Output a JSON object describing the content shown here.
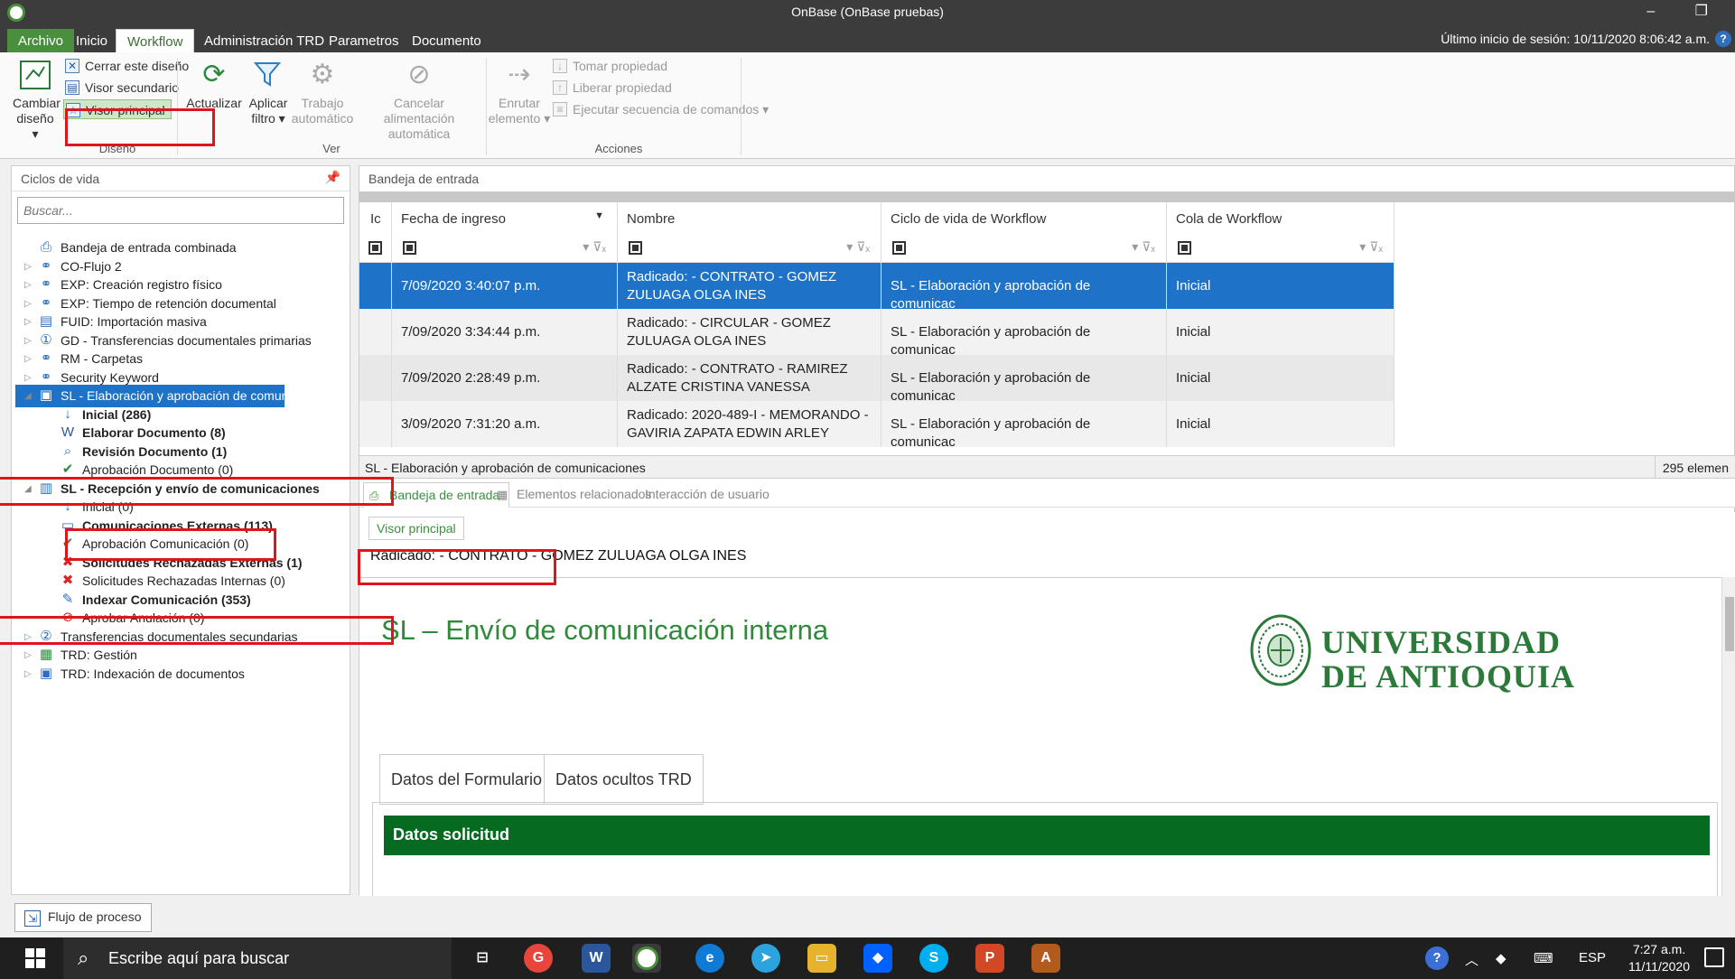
{
  "window": {
    "title": "OnBase (OnBase pruebas)",
    "controls": "– ❐"
  },
  "menu": {
    "tabs": [
      "Archivo",
      "Inicio",
      "Workflow",
      "Administración TRD",
      "Parametros",
      "Documento"
    ],
    "active": "Workflow",
    "session": "Último inicio de sesión: 10/11/2020 8:06:42 a.m.",
    "help": "?"
  },
  "ribbon": {
    "diseno": {
      "cambiar_label1": "Cambiar",
      "cambiar_label2": "diseño ▾",
      "cerrar": "Cerrar este diseño",
      "secundario": "Visor secundario",
      "principal": "Visor principal",
      "group": "Diseño"
    },
    "ver": {
      "actualizar": "Actualizar",
      "aplicar1": "Aplicar",
      "aplicar2": "filtro ▾",
      "trabajo1": "Trabajo",
      "trabajo2": "automático",
      "cancelar1": "Cancelar alimentación",
      "cancelar2": "automática",
      "group": "Ver"
    },
    "acciones": {
      "enrutar1": "Enrutar",
      "enrutar2": "elemento ▾",
      "tomar": "Tomar propiedad",
      "liberar": "Liberar propiedad",
      "ejecutar": "Ejecutar secuencia de comandos ▾",
      "group": "Acciones"
    }
  },
  "left_panel": {
    "title": "Ciclos de vida",
    "search_placeholder": "Buscar...",
    "tree": [
      {
        "label": "Bandeja de entrada combinada",
        "icon": "inbox-icon"
      },
      {
        "label": "CO-Flujo 2",
        "icon": "workflow-icon"
      },
      {
        "label": "EXP: Creación registro físico",
        "icon": "workflow-icon"
      },
      {
        "label": "EXP: Tiempo de retención documental",
        "icon": "workflow-icon"
      },
      {
        "label": "FUID: Importación masiva",
        "icon": "document-icon"
      },
      {
        "label": "GD - Transferencias documentales primarias",
        "icon": "number-one-icon"
      },
      {
        "label": "RM - Carpetas",
        "icon": "workflow-icon"
      },
      {
        "label": "Security Keyword",
        "icon": "workflow-icon"
      },
      {
        "label": "SL - Elaboración y aprobación de comunic...",
        "icon": "lifecycle-icon"
      },
      {
        "label": "Inicial (286)",
        "icon": "arrow-down-icon"
      },
      {
        "label": "Elaborar Documento (8)",
        "icon": "word-doc-icon"
      },
      {
        "label": "Revisión Documento (1)",
        "icon": "review-icon"
      },
      {
        "label": "Aprobación Documento (0)",
        "icon": "check-icon"
      },
      {
        "label": "SL - Recepción y envío de comunicaciones",
        "icon": "book-icon"
      },
      {
        "label": "Inicial (0)",
        "icon": "arrow-down-icon"
      },
      {
        "label": "Comunicaciones Externas (113)",
        "icon": "screen-icon"
      },
      {
        "label": "Aprobación Comunicación (0)",
        "icon": "check-icon"
      },
      {
        "label": "Solicitudes Rechazadas Externas (1)",
        "icon": "reject-icon"
      },
      {
        "label": "Solicitudes Rechazadas Internas (0)",
        "icon": "reject-icon"
      },
      {
        "label": "Indexar Comunicación (353)",
        "icon": "index-icon"
      },
      {
        "label": "Aprobar Anulación (0)",
        "icon": "cancel-icon"
      },
      {
        "label": "Transferencias documentales secundarias",
        "icon": "number-two-icon"
      },
      {
        "label": "TRD: Gestión",
        "icon": "grid-icon"
      },
      {
        "label": "TRD: Indexación de documentos",
        "icon": "save-icon"
      }
    ]
  },
  "inbox": {
    "title": "Bandeja de entrada",
    "columns": [
      "Ic",
      "Fecha de ingreso",
      "Nombre",
      "Ciclo de vida de Workflow",
      "Cola de Workflow"
    ],
    "rows": [
      {
        "fecha": "7/09/2020 3:40:07 p.m.",
        "nombre1": "Radicado:  - CONTRATO - GOMEZ",
        "nombre2": "ZULUAGA OLGA INES",
        "ciclo": "SL - Elaboración y aprobación de comunicac",
        "cola": "Inicial"
      },
      {
        "fecha": "7/09/2020 3:34:44 p.m.",
        "nombre1": "Radicado:  - CIRCULAR - GOMEZ",
        "nombre2": "ZULUAGA OLGA INES",
        "ciclo": "SL - Elaboración y aprobación de comunicac",
        "cola": "Inicial"
      },
      {
        "fecha": "7/09/2020 2:28:49 p.m.",
        "nombre1": "Radicado:  - CONTRATO - RAMIREZ",
        "nombre2": "ALZATE CRISTINA VANESSA",
        "ciclo": "SL - Elaboración y aprobación de comunicac",
        "cola": "Inicial"
      },
      {
        "fecha": "3/09/2020 7:31:20 a.m.",
        "nombre1": "Radicado: 2020-489-I - MEMORANDO -",
        "nombre2": "GAVIRIA ZAPATA EDWIN ARLEY",
        "ciclo": "SL - Elaboración y aprobación de comunicac",
        "cola": "Inicial"
      }
    ],
    "status_left": "SL - Elaboración y aprobación de comunicaciones",
    "status_right": "295 elemen",
    "subtabs": [
      "Bandeja de entrada",
      "Elementos relacionados",
      "Interacción de usuario"
    ]
  },
  "viewer": {
    "tab": "Visor principal",
    "radicado": "Radicado:  - CONTRATO - GOMEZ ZULUAGA OLGA INES",
    "doc_title": "SL – Envío de comunicación interna",
    "logo_line1": "UNIVERSIDAD",
    "logo_line2": "DE ANTIOQUIA",
    "form_tabs": [
      "Datos del Formulario",
      "Datos ocultos TRD"
    ],
    "section": "Datos solicitud"
  },
  "bottom": {
    "flujo": "Flujo de proceso"
  },
  "taskbar": {
    "search": "Escribe aquí para buscar",
    "lang": "ESP",
    "time": "7:27 a.m.",
    "date": "11/11/2020"
  },
  "colors": {
    "accent_green": "#4a8f3e",
    "selection_blue": "#1e73c8",
    "form_green": "#066b21",
    "annotation_red": "#e0141c"
  }
}
